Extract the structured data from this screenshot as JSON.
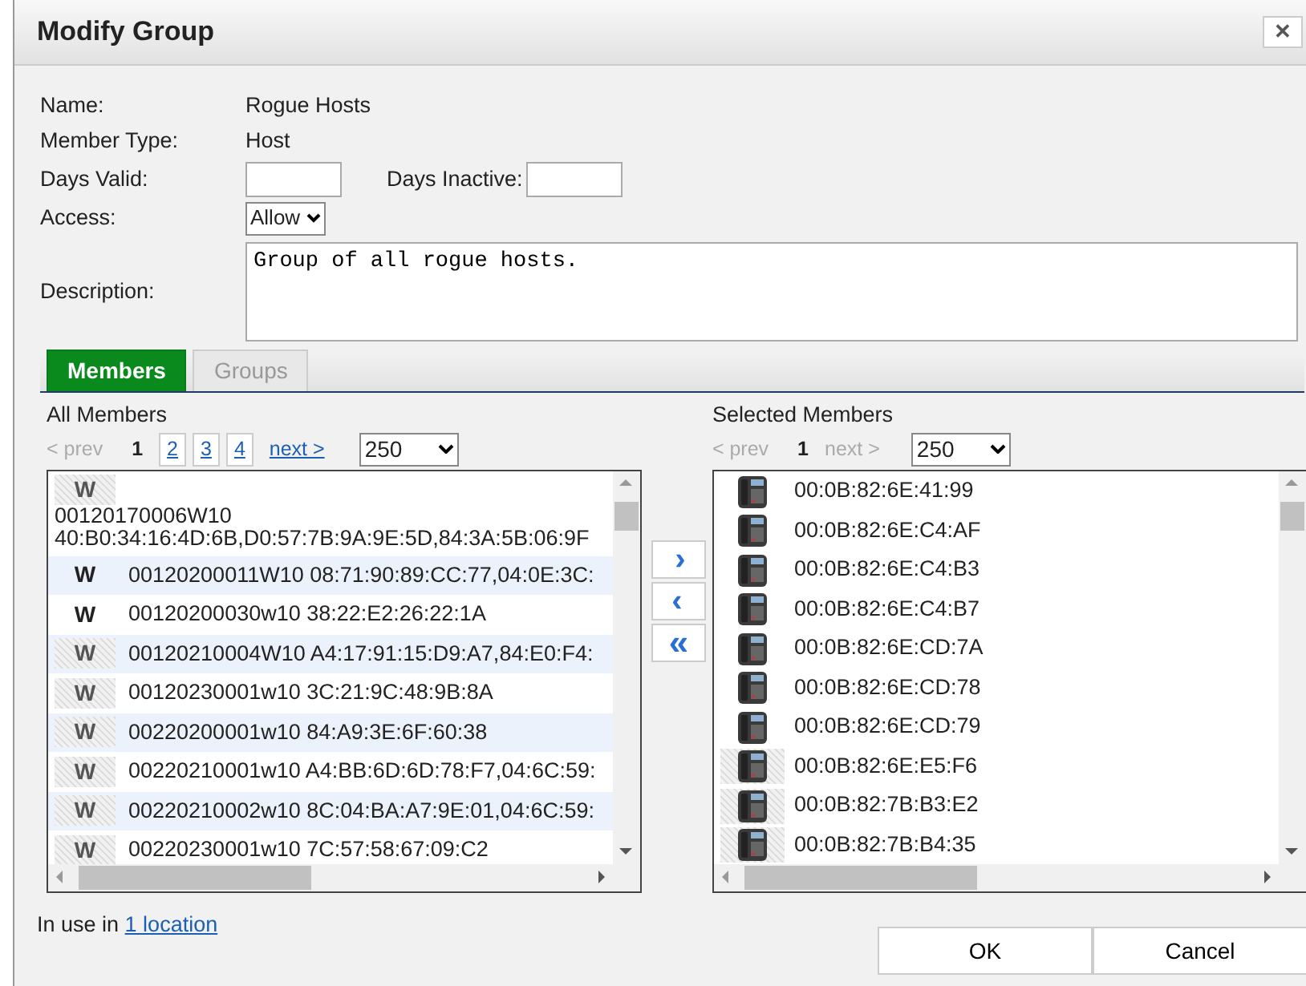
{
  "window": {
    "title": "Modify Group",
    "close": "✕"
  },
  "fields": [
    {
      "label": "Name:",
      "kind": "text",
      "value": "Rogue Hosts"
    },
    {
      "label": "Member Type:",
      "kind": "text",
      "value": "Host"
    },
    {
      "label": "Days Valid:",
      "kind": "pair",
      "label2": "Days Inactive:"
    },
    {
      "label": "Access:",
      "kind": "select",
      "value": "Allow"
    },
    {
      "label": "Description:",
      "kind": "textarea",
      "value": "Group of all rogue hosts."
    }
  ],
  "tabs": [
    {
      "label": "Members",
      "selected": true
    },
    {
      "label": "Groups",
      "selected": false
    }
  ],
  "all_members": {
    "title": "All Members",
    "pager": [
      {
        "label": "< prev",
        "kind": "disabled"
      },
      {
        "label": "1",
        "kind": "current"
      },
      {
        "label": "2",
        "kind": "page"
      },
      {
        "label": "3",
        "kind": "page"
      },
      {
        "label": "4",
        "kind": "page"
      },
      {
        "label": "next >",
        "kind": "link"
      }
    ],
    "page_size": "250",
    "items": [
      {
        "kind": "stacked",
        "badge": "W",
        "dimmed": true,
        "text": "00120170006W10 40:B0:34:16:4D:6B,D0:57:7B:9A:9E:5D,84:3A:5B:06:9F"
      },
      {
        "kind": "row",
        "badge": "W",
        "dimmed": false,
        "text": "00120200011W10 08:71:90:89:CC:77,04:0E:3C:"
      },
      {
        "kind": "row",
        "badge": "W",
        "dimmed": false,
        "text": "00120200030w10 38:22:E2:26:22:1A"
      },
      {
        "kind": "row",
        "badge": "W",
        "dimmed": true,
        "text": "00120210004W10 A4:17:91:15:D9:A7,84:E0:F4:"
      },
      {
        "kind": "row",
        "badge": "W",
        "dimmed": true,
        "text": "00120230001w10 3C:21:9C:48:9B:8A"
      },
      {
        "kind": "row",
        "badge": "W",
        "dimmed": true,
        "text": "00220200001w10 84:A9:3E:6F:60:38"
      },
      {
        "kind": "row",
        "badge": "W",
        "dimmed": true,
        "text": "00220210001w10 A4:BB:6D:6D:78:F7,04:6C:59:"
      },
      {
        "kind": "row",
        "badge": "W",
        "dimmed": true,
        "text": "00220210002w10 8C:04:BA:A7:9E:01,04:6C:59:"
      },
      {
        "kind": "row",
        "badge": "W",
        "dimmed": true,
        "text": "00220230001w10 7C:57:58:67:09:C2"
      }
    ]
  },
  "move_buttons": [
    {
      "kind": "add",
      "label": "›"
    },
    {
      "kind": "remove",
      "label": "‹"
    },
    {
      "kind": "remove_all",
      "label": "«"
    }
  ],
  "selected_members": {
    "title": "Selected Members",
    "pager": [
      {
        "label": "< prev",
        "kind": "disabled"
      },
      {
        "label": "1",
        "kind": "current"
      },
      {
        "label": "next >",
        "kind": "disabled"
      }
    ],
    "page_size": "250",
    "items": [
      {
        "kind": "phone",
        "dimmed": false,
        "text": "00:0B:82:6E:41:99"
      },
      {
        "kind": "phone",
        "dimmed": false,
        "text": "00:0B:82:6E:C4:AF"
      },
      {
        "kind": "phone",
        "dimmed": false,
        "text": "00:0B:82:6E:C4:B3"
      },
      {
        "kind": "phone",
        "dimmed": false,
        "text": "00:0B:82:6E:C4:B7"
      },
      {
        "kind": "phone",
        "dimmed": false,
        "text": "00:0B:82:6E:CD:7A"
      },
      {
        "kind": "phone",
        "dimmed": false,
        "text": "00:0B:82:6E:CD:78"
      },
      {
        "kind": "phone",
        "dimmed": false,
        "text": "00:0B:82:6E:CD:79"
      },
      {
        "kind": "phone",
        "dimmed": true,
        "text": "00:0B:82:6E:E5:F6"
      },
      {
        "kind": "phone",
        "dimmed": true,
        "text": "00:0B:82:7B:B3:E2"
      },
      {
        "kind": "phone",
        "dimmed": true,
        "text": "00:0B:82:7B:B4:35"
      }
    ]
  },
  "usage": {
    "prefix": "In use in",
    "link": "1 location"
  },
  "buttons": [
    "OK",
    "Cancel"
  ]
}
